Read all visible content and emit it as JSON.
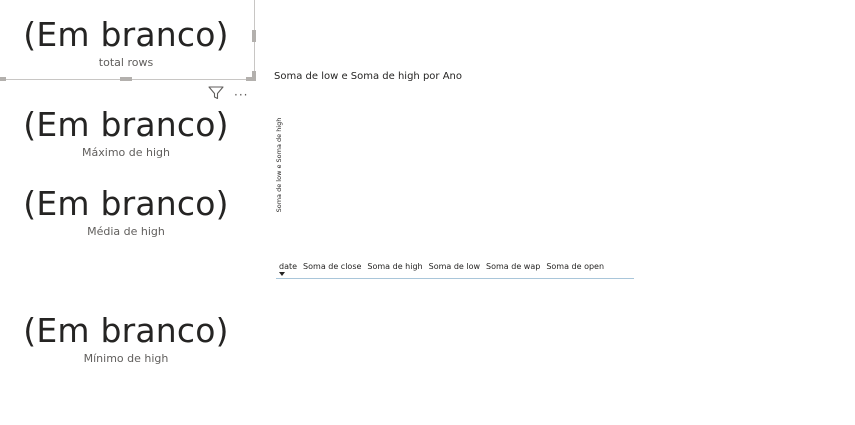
{
  "cards": [
    {
      "value": "(Em branco)",
      "label": "total rows"
    },
    {
      "value": "(Em branco)",
      "label": "Máximo de high"
    },
    {
      "value": "(Em branco)",
      "label": "Média de high"
    },
    {
      "value": "(Em branco)",
      "label": "Mínimo de high"
    }
  ],
  "visual_header": {
    "filter_icon": "filter-icon",
    "more_icon": "more-options-icon",
    "more_glyph": "···"
  },
  "chart": {
    "title": "Soma de low e Soma de high por Ano",
    "ylabel": "Soma de low e Soma de high"
  },
  "table": {
    "columns": [
      "date",
      "Soma de close",
      "Soma de high",
      "Soma de low",
      "Soma de wap",
      "Soma de open"
    ],
    "sort_column": "date",
    "sort_direction": "descending"
  }
}
